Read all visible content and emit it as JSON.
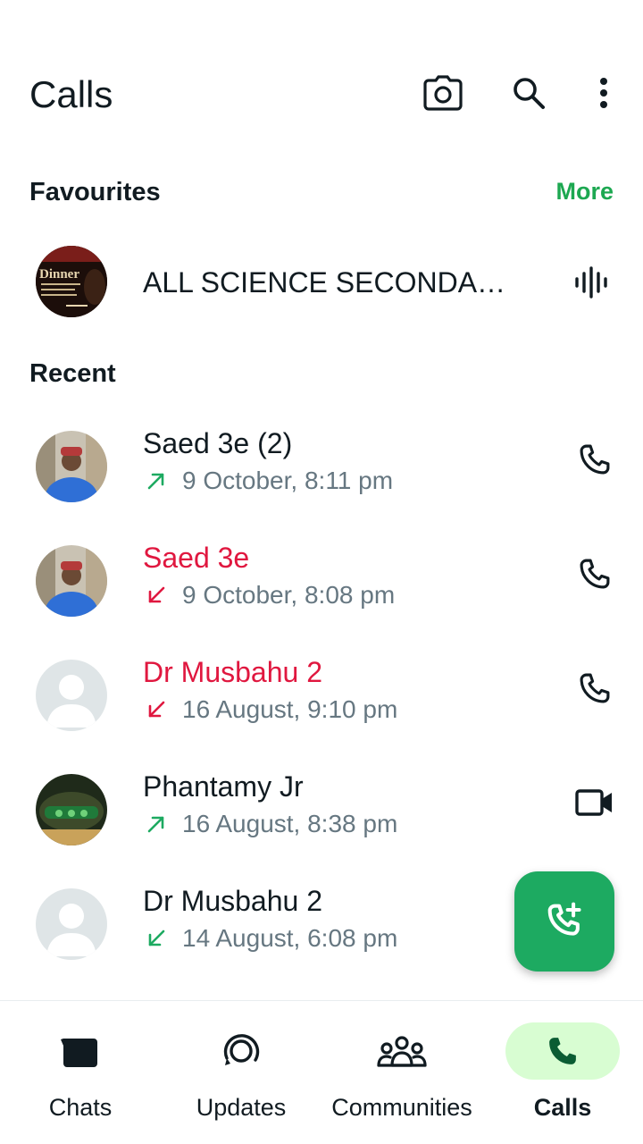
{
  "header": {
    "title": "Calls"
  },
  "favourites": {
    "section_title": "Favourites",
    "more_label": "More",
    "items": [
      {
        "name": "ALL SCIENCE SECONDARY...",
        "avatar_text": "Dinner"
      }
    ]
  },
  "recent": {
    "section_title": "Recent",
    "items": [
      {
        "name": "Saed 3e (2)",
        "time": "9 October, 8:11 pm",
        "direction": "outgoing",
        "missed": false,
        "call_type": "voice"
      },
      {
        "name": "Saed 3e",
        "time": "9 October, 8:08 pm",
        "direction": "incoming",
        "missed": true,
        "call_type": "voice"
      },
      {
        "name": "Dr Musbahu 2",
        "time": "16 August, 9:10 pm",
        "direction": "incoming",
        "missed": true,
        "call_type": "voice"
      },
      {
        "name": "Phantamy Jr",
        "time": "16 August, 8:38 pm",
        "direction": "outgoing",
        "missed": false,
        "call_type": "video"
      },
      {
        "name": "Dr Musbahu 2",
        "time": "14 August, 6:08 pm",
        "direction": "incoming",
        "missed": false,
        "call_type": "voice"
      }
    ]
  },
  "bottom_nav": {
    "items": [
      {
        "label": "Chats",
        "icon": "chat-icon",
        "active": false
      },
      {
        "label": "Updates",
        "icon": "updates-icon",
        "active": false
      },
      {
        "label": "Communities",
        "icon": "communities-icon",
        "active": false
      },
      {
        "label": "Calls",
        "icon": "phone-icon",
        "active": true
      }
    ]
  },
  "colors": {
    "accent": "#1daa61",
    "missed": "#e0173f",
    "secondary_text": "#667781",
    "active_pill": "#d8fdd2"
  }
}
